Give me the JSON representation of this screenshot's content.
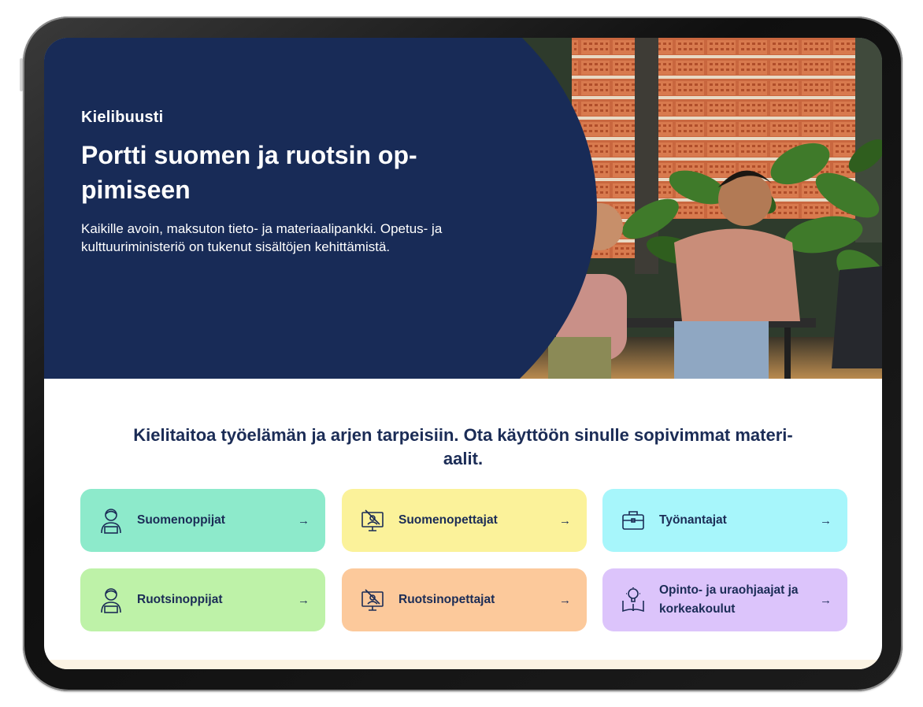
{
  "hero": {
    "eyebrow": "Kielibuusti",
    "title_line1": "Portti suomen ja ruotsin op-",
    "title_line2": "pimiseen",
    "description": "Kaikille avoin, maksuton tieto- ja materiaalipankki. Opetus- ja kulttuuriministeriö on tukenut sisältöjen kehittämistä.",
    "photo_icon": "students-photo"
  },
  "section": {
    "heading_line1": "Kielitaitoa työelämän ja arjen tarpeisiin. Ota käyttöön sinulle sopivimmat materi-",
    "heading_line2": "aalit."
  },
  "cards": [
    {
      "label": "Suomenoppijat",
      "icon": "learner-icon",
      "color": "#8deacb",
      "arrow": "→"
    },
    {
      "label": "Suomenopettajat",
      "icon": "teacher-screen-icon",
      "color": "#fbf29a",
      "arrow": "→"
    },
    {
      "label": "Työnantajat",
      "icon": "briefcase-icon",
      "color": "#a7f6fb",
      "arrow": "→"
    },
    {
      "label": "Ruotsinoppijat",
      "icon": "learner-icon",
      "color": "#bef2a8",
      "arrow": "→"
    },
    {
      "label": "Ruotsinopettajat",
      "icon": "teacher-screen-icon",
      "color": "#fcc99b",
      "arrow": "→"
    },
    {
      "label": "Opinto- ja uraohjaajat ja korkeakoulut",
      "icon": "lightbulb-book-icon",
      "color": "#dcc4fb",
      "arrow": "→"
    }
  ],
  "colors": {
    "navy": "#182b57",
    "text_dark": "#1b2c56",
    "device_frame": "#141414"
  }
}
